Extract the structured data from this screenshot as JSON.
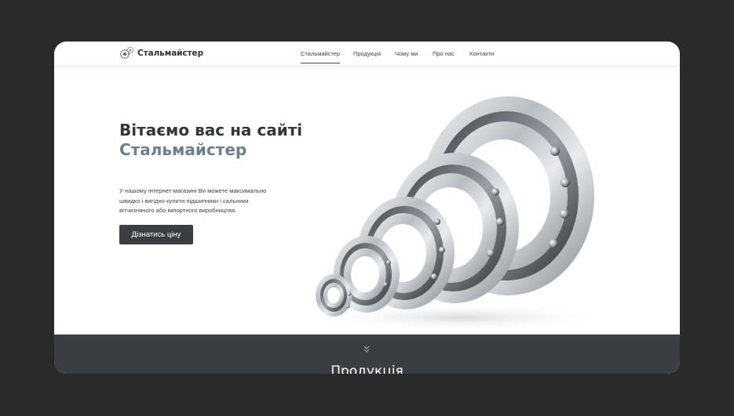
{
  "brand": {
    "name": "Стальмайстер",
    "logo_icon": "gears-icon"
  },
  "nav": {
    "items": [
      {
        "label": "Стальмайстер",
        "active": true
      },
      {
        "label": "Продукція",
        "active": false
      },
      {
        "label": "Чому ми",
        "active": false
      },
      {
        "label": "Про нас",
        "active": false
      },
      {
        "label": "Контакти",
        "active": false
      }
    ]
  },
  "hero": {
    "title_line1": "Вітаємо вас на сайті",
    "title_line2": "Стальмайстер",
    "description": "У нашому інтернет-магазині Ви можете максимально швидко і вигідно купити підшипники і сальники вітчизняного або імпортного виробництва.",
    "cta_label": "Дізнатись ціну",
    "image": "ball-bearings-image"
  },
  "products": {
    "scroll_icon": "double-chevron-down-icon",
    "title": "Продукція"
  },
  "colors": {
    "page_bg": "#2a2a2a",
    "heading": "#33383e",
    "accent_heading": "#6b7f8e",
    "button_bg": "#3a3e43",
    "dark_section": "#3a3e43"
  }
}
